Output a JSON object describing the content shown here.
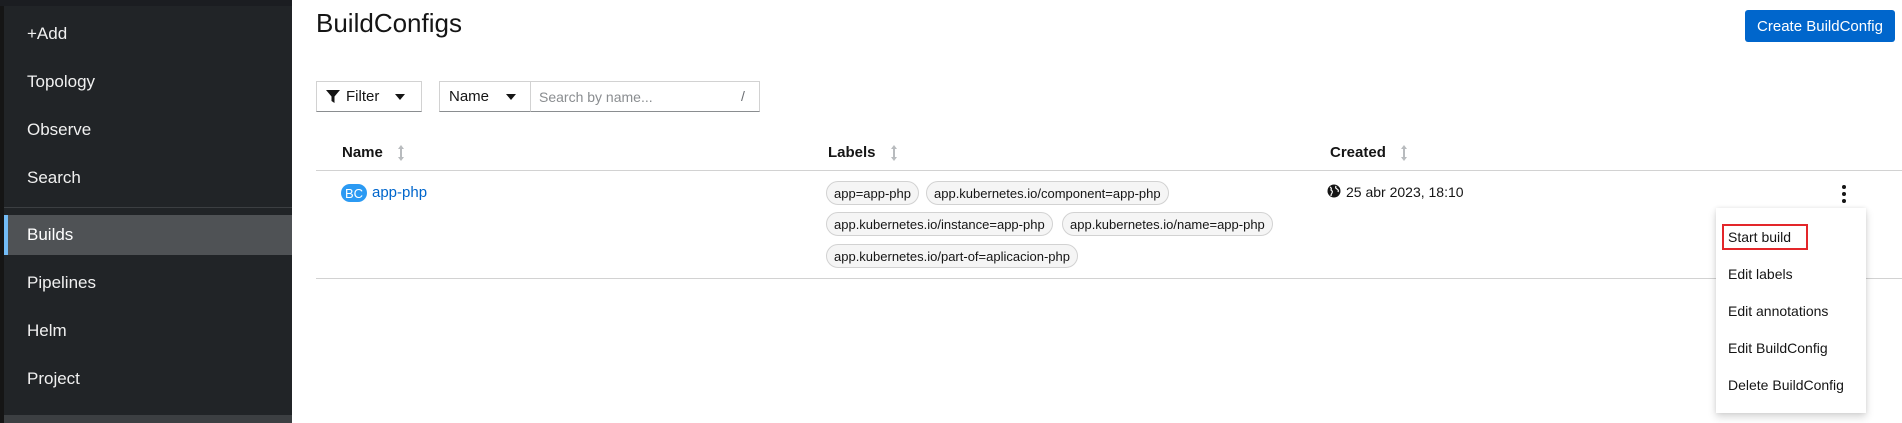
{
  "sidebar": {
    "items": [
      {
        "label": "+Add"
      },
      {
        "label": "Topology"
      },
      {
        "label": "Observe"
      },
      {
        "label": "Search"
      },
      {
        "label": "Builds",
        "active": true
      },
      {
        "label": "Pipelines"
      },
      {
        "label": "Helm"
      },
      {
        "label": "Project"
      }
    ]
  },
  "header": {
    "title": "BuildConfigs",
    "create_button": "Create BuildConfig"
  },
  "toolbar": {
    "filter_label": "Filter",
    "name_select_value": "Name",
    "search_placeholder": "Search by name...",
    "search_shortcut": "/"
  },
  "table": {
    "columns": [
      "Name",
      "Labels",
      "Created"
    ],
    "rows": [
      {
        "badge": "BC",
        "name": "app-php",
        "labels": [
          "app=app-php",
          "app.kubernetes.io/component=app-php",
          "app.kubernetes.io/instance=app-php",
          "app.kubernetes.io/name=app-php",
          "app.kubernetes.io/part-of=aplicacion-php"
        ],
        "created": "25 abr 2023, 18:10"
      }
    ]
  },
  "actions_menu": {
    "items": [
      {
        "label": "Start build",
        "highlighted": true
      },
      {
        "label": "Edit labels"
      },
      {
        "label": "Edit annotations"
      },
      {
        "label": "Edit BuildConfig"
      },
      {
        "label": "Delete BuildConfig"
      }
    ]
  },
  "colors": {
    "sidebar_bg": "#212427",
    "sidebar_active_bg": "#4f5255",
    "active_indicator": "#73bcf7",
    "primary": "#0066cc",
    "badge_bc": "#2b9af3",
    "highlight": "#e3262a"
  }
}
